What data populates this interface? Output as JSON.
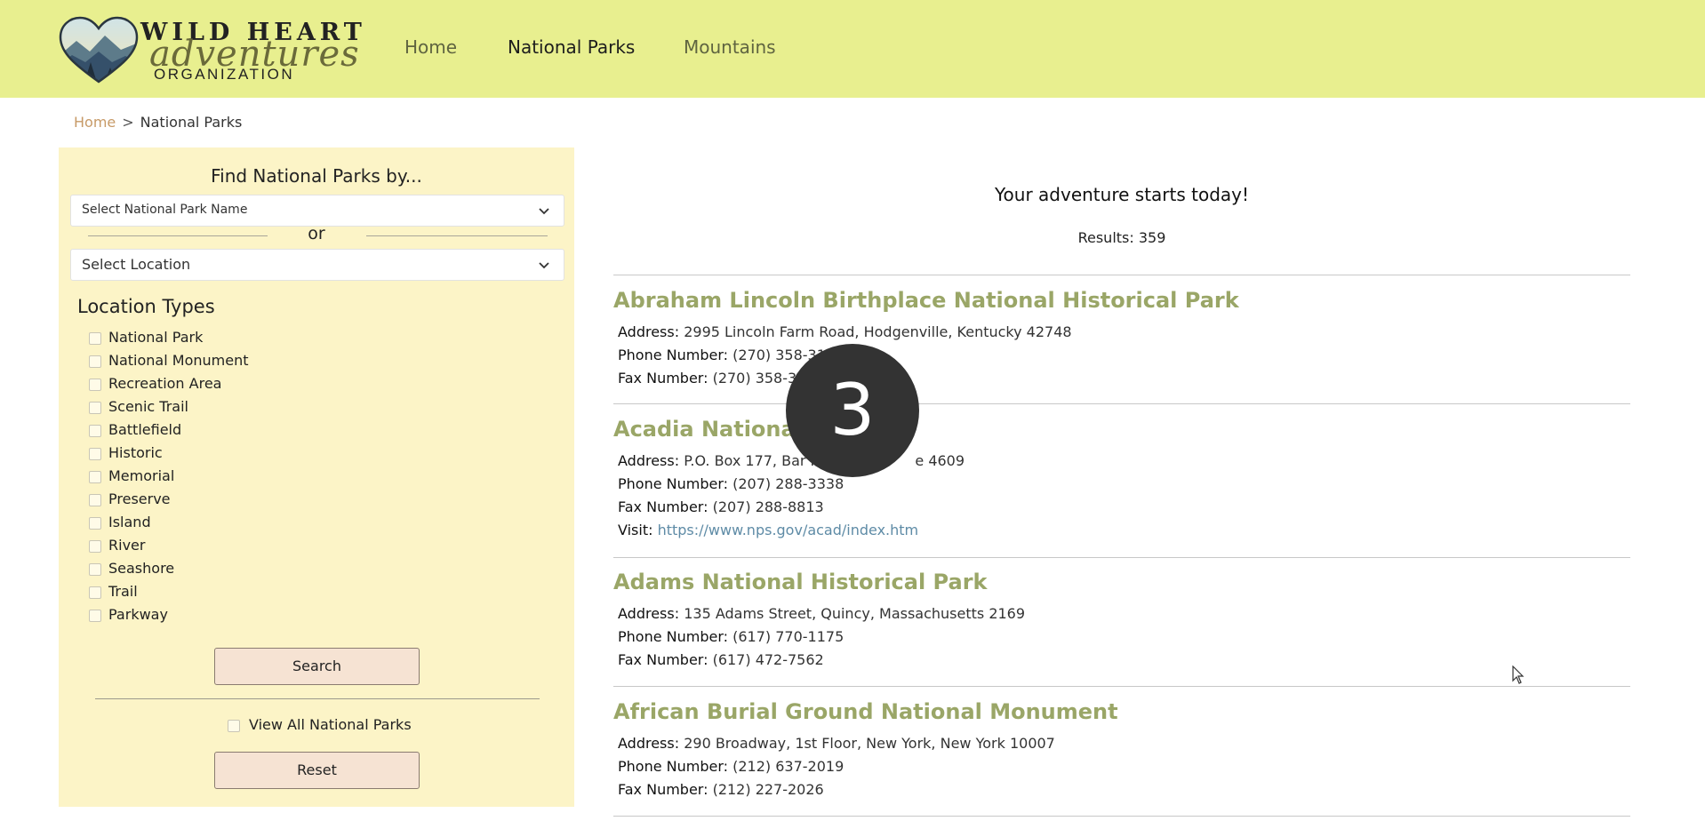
{
  "header": {
    "logo": {
      "line1": "WILD HEART",
      "line2": "adventures",
      "line3": "ORGANIZATION"
    },
    "nav": [
      {
        "label": "Home"
      },
      {
        "label": "National Parks"
      },
      {
        "label": "Mountains"
      }
    ],
    "background_color": "#e8ef8f"
  },
  "breadcrumb": {
    "home": "Home",
    "separator": ">",
    "current": "National Parks"
  },
  "sidebar": {
    "title": "Find National Parks by...",
    "park_name_select": "Select National Park Name",
    "or_text": "or",
    "location_select": "Select Location",
    "location_types_title": "Location Types",
    "location_types": [
      "National Park",
      "National Monument",
      "Recreation Area",
      "Scenic Trail",
      "Battlefield",
      "Historic",
      "Memorial",
      "Preserve",
      "Island",
      "River",
      "Seashore",
      "Trail",
      "Parkway"
    ],
    "search_button": "Search",
    "view_all_label": "View All National Parks",
    "reset_button": "Reset",
    "background_color": "#fcf4c7"
  },
  "main": {
    "tagline": "Your adventure starts today!",
    "results": "Results: 359",
    "parks": [
      {
        "name": "Abraham Lincoln Birthplace National Historical Park",
        "address_label": "Address:",
        "address": "2995 Lincoln Farm Road, Hodgenville, Kentucky 42748",
        "phone_label": "Phone Number:",
        "phone": "(270) 358-31",
        "fax_label": "Fax Number:",
        "fax": "(270) 358-3"
      },
      {
        "name": "Acadia National",
        "address_label": "Address:",
        "address": "P.O. Box 177, Bar Ha",
        "address_tail": "e 4609",
        "phone_label": "Phone Number:",
        "phone": "(207) 288-3338",
        "fax_label": "Fax Number:",
        "fax": "(207) 288-8813",
        "visit_label": "Visit:",
        "visit_url": "https://www.nps.gov/acad/index.htm"
      },
      {
        "name": "Adams National Historical Park",
        "address_label": "Address:",
        "address": "135 Adams Street, Quincy, Massachusetts 2169",
        "phone_label": "Phone Number:",
        "phone": "(617) 770-1175",
        "fax_label": "Fax Number:",
        "fax": "(617) 472-7562"
      },
      {
        "name": "African Burial Ground National Monument",
        "address_label": "Address:",
        "address": "290 Broadway, 1st Floor, New York, New York 10007",
        "phone_label": "Phone Number:",
        "phone": "(212) 637-2019",
        "fax_label": "Fax Number:",
        "fax": "(212) 227-2026"
      }
    ],
    "title_color": "#9aa667",
    "link_color": "#5e8ba6"
  },
  "overlay": {
    "badge_number": "3"
  }
}
